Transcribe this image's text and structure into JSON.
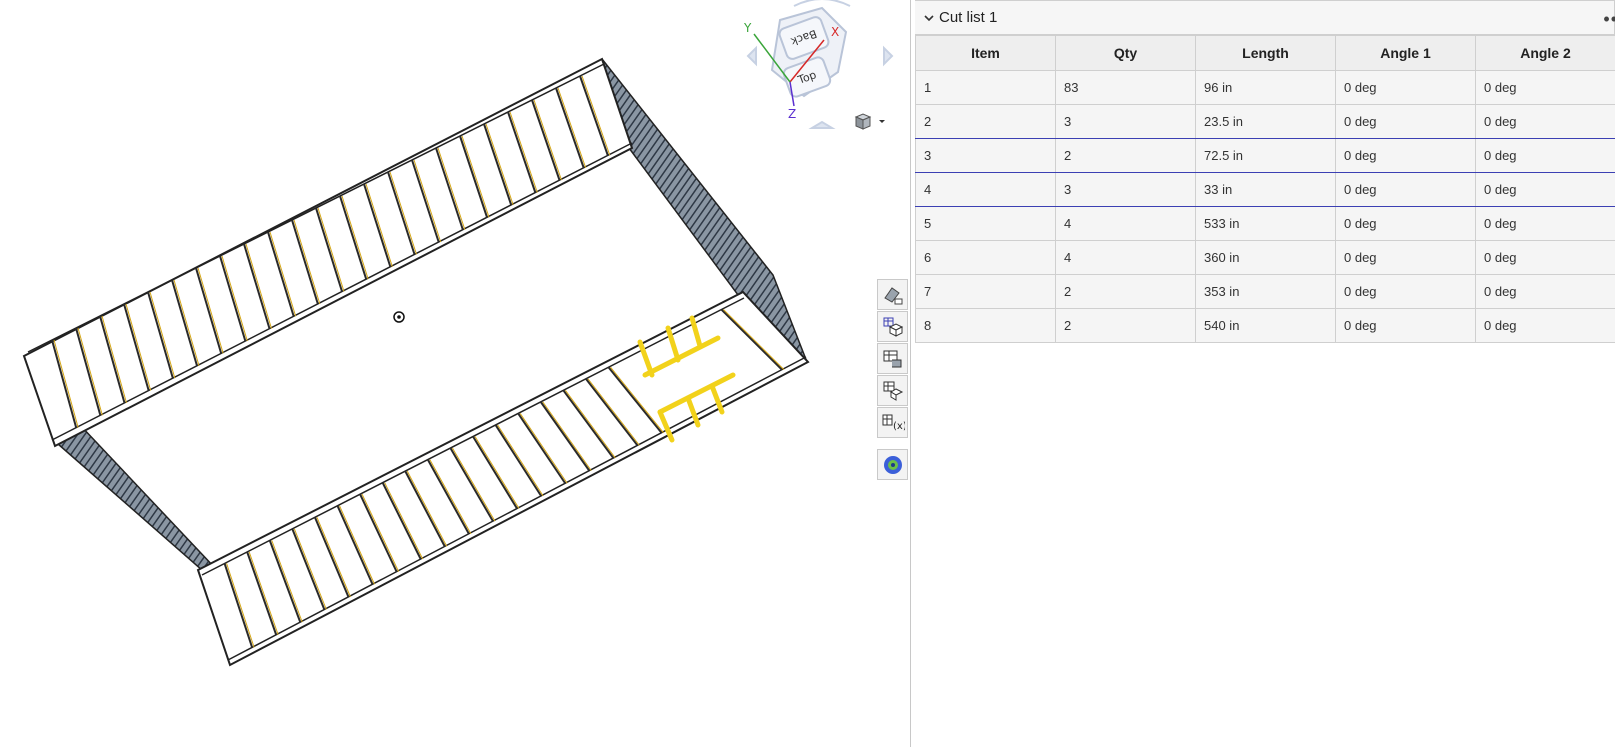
{
  "viewcube": {
    "face_back": "Back",
    "face_top": "Top",
    "axis_x": "X",
    "axis_y": "Y",
    "axis_z": "Z",
    "colors": {
      "x": "#d62828",
      "y": "#3aa53a",
      "z": "#5b2fd0"
    }
  },
  "view_menu_icon": "cube-icon",
  "toolbar": {
    "tools": [
      {
        "name": "appearance-tool",
        "icon": "paint-bucket-icon"
      },
      {
        "name": "section-view-tool",
        "icon": "grid-cube-icon"
      },
      {
        "name": "cut-list-tool",
        "icon": "table-stack-icon"
      },
      {
        "name": "configurations-tool",
        "icon": "table-cube-icon"
      },
      {
        "name": "variables-tool",
        "icon": "table-variable-icon"
      },
      {
        "name": "render-tool",
        "icon": "render-sphere-icon"
      }
    ]
  },
  "panel": {
    "title": "Cut list 1",
    "more": "••",
    "columns": [
      "Item",
      "Qty",
      "Length",
      "Angle 1",
      "Angle 2"
    ],
    "rows": [
      {
        "item": "1",
        "qty": "83",
        "length": "96 in",
        "angle1": "0 deg",
        "angle2": "0 deg"
      },
      {
        "item": "2",
        "qty": "3",
        "length": "23.5 in",
        "angle1": "0 deg",
        "angle2": "0 deg"
      },
      {
        "item": "3",
        "qty": "2",
        "length": "72.5 in",
        "angle1": "0 deg",
        "angle2": "0 deg"
      },
      {
        "item": "4",
        "qty": "3",
        "length": "33 in",
        "angle1": "0 deg",
        "angle2": "0 deg"
      },
      {
        "item": "5",
        "qty": "4",
        "length": "533 in",
        "angle1": "0 deg",
        "angle2": "0 deg"
      },
      {
        "item": "6",
        "qty": "4",
        "length": "360 in",
        "angle1": "0 deg",
        "angle2": "0 deg"
      },
      {
        "item": "7",
        "qty": "2",
        "length": "353 in",
        "angle1": "0 deg",
        "angle2": "0 deg"
      },
      {
        "item": "8",
        "qty": "2",
        "length": "540 in",
        "angle1": "0 deg",
        "angle2": "0 deg"
      }
    ],
    "highlight_color": "#3b3fb3"
  },
  "colors": {
    "stud": "#2a2a2a",
    "stud_edge": "#d4a514",
    "highlight_frame": "#f2d21b",
    "wall_dark": "#5d6b7a"
  }
}
